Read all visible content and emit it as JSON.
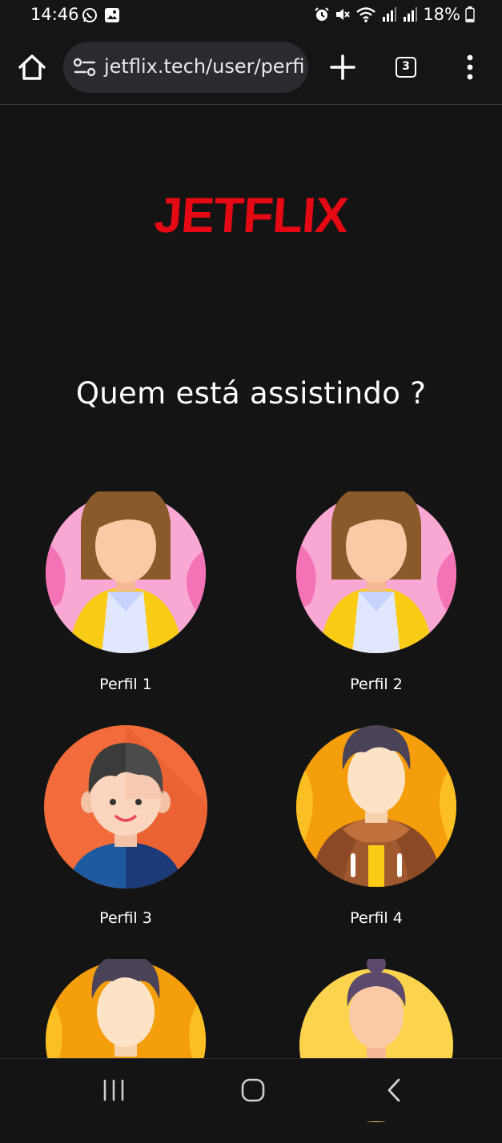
{
  "status_bar": {
    "time": "14:46",
    "battery_percent": "18%",
    "left_icons": [
      "whatsapp-icon",
      "gallery-icon"
    ],
    "right_icons": [
      "alarm-icon",
      "mute-icon",
      "wifi-icon",
      "signal-icon",
      "signal-icon",
      "battery-icon"
    ],
    "battery_level": 0.18
  },
  "browser": {
    "url": "jetflix.tech/user/perfi",
    "tab_count": "3",
    "icons": [
      "home-icon",
      "site-settings-icon",
      "plus-icon",
      "more-vert-icon"
    ]
  },
  "page": {
    "logo": "JETFLIX",
    "heading": "Quem está assistindo ?",
    "profiles": [
      {
        "name": "Perfil 1",
        "avatar": "woman-avatar"
      },
      {
        "name": "Perfil 2",
        "avatar": "woman-avatar"
      },
      {
        "name": "Perfil 3",
        "avatar": "boy-avatar"
      },
      {
        "name": "Perfil 4",
        "avatar": "man-hoodie-avatar"
      },
      {
        "name": "",
        "avatar": "man-avatar"
      },
      {
        "name": "",
        "avatar": "woman-bun-avatar"
      }
    ]
  },
  "colors": {
    "background": "#141414",
    "brand": "#E50914"
  },
  "nav_bar": {
    "icons": [
      "recents-icon",
      "home-circle-icon",
      "back-icon"
    ]
  }
}
